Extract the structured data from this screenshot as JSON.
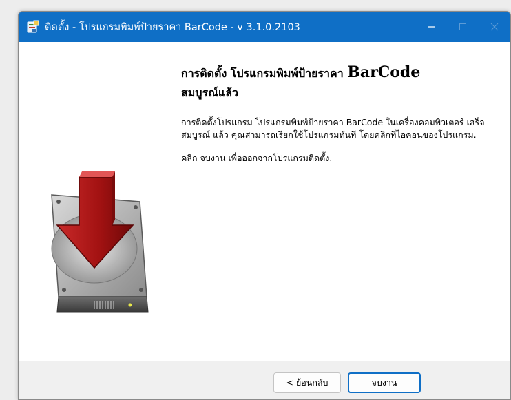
{
  "window": {
    "title": "ติดตั้ง - โปรแกรมพิมพ์ป้ายราคา BarCode - v 3.1.0.2103",
    "accent_color": "#0f6fc6",
    "app_icon": "installer-icon",
    "controls": {
      "minimize_icon": "minimize-icon",
      "maximize_icon": "maximize-icon",
      "close_icon": "close-icon"
    }
  },
  "page": {
    "heading_prefix": "การติดตั้ง โปรแกรมพิมพ์ป้ายราคา ",
    "heading_brand": "BarCode",
    "heading_line2": "สมบูรณ์แล้ว",
    "body_paragraph_1": "การติดตั้งโปรแกรม โปรแกรมพิมพ์ป้ายราคา BarCode ในเครื่องคอมพิวเตอร์ เสร็จสมบูรณ์ แล้ว คุณสามารถเรียกใช้โปรแกรมทันที โดยคลิกที่ไอคอนของโปรแกรม.",
    "body_paragraph_2": "คลิก จบงาน เพื่อออกจากโปรแกรมติดตั้ง.",
    "side_image_icon": "hard-drive-download-icon"
  },
  "footer": {
    "back_label": "< ย้อนกลับ",
    "finish_label": "จบงาน"
  }
}
